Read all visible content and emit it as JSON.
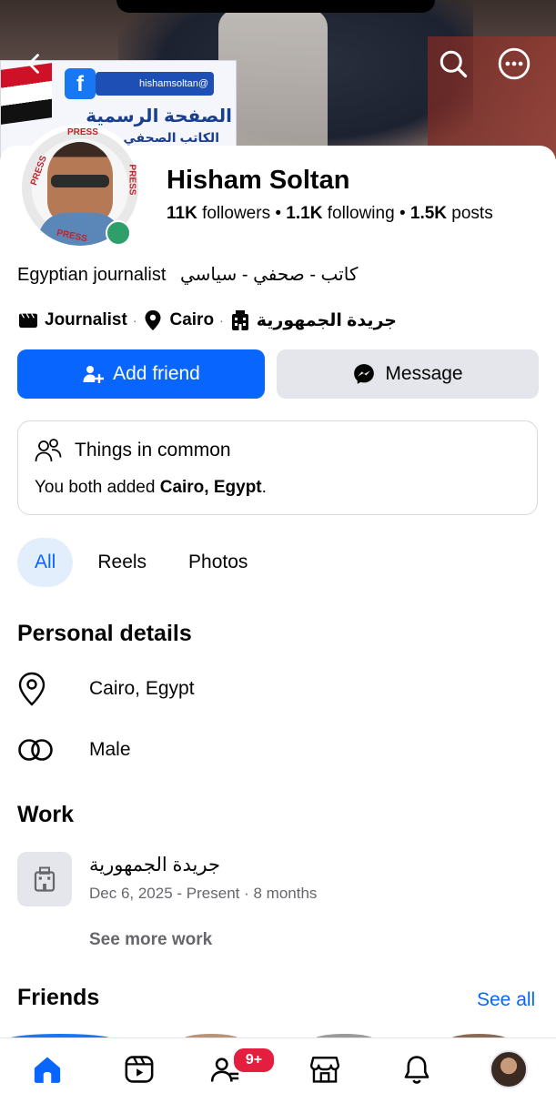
{
  "cover": {
    "poster_handle": "hishamsoltan@",
    "poster_line1": "الصفحة الرسمية",
    "poster_line2": "الكاتب الصحفي"
  },
  "profile": {
    "name": "Hisham Soltan",
    "followers_count": "11K",
    "followers_label": "followers",
    "following_count": "1.1K",
    "following_label": "following",
    "posts_count": "1.5K",
    "posts_label": "posts",
    "bio_en": "Egyptian journalist",
    "bio_ar": "كاتب - صحفي  - سياسي",
    "fact_job": "Journalist",
    "fact_city": "Cairo",
    "fact_employer": "جريدة الجمهورية",
    "avatar_press_top": "PRESS",
    "avatar_press_left": "PRESS",
    "avatar_press_right": "PRESS",
    "avatar_press_bottom": "PRESS"
  },
  "actions": {
    "add_friend": "Add friend",
    "message": "Message"
  },
  "common": {
    "title": "Things in common",
    "desc_prefix": "You both added ",
    "desc_place": "Cairo, Egypt",
    "desc_suffix": "."
  },
  "tabs": [
    "All",
    "Reels",
    "Photos"
  ],
  "personal": {
    "heading": "Personal details",
    "location": "Cairo, Egypt",
    "gender": "Male"
  },
  "work": {
    "heading": "Work",
    "employer": "جريدة الجمهورية",
    "dates": "Dec 6, 2025 - Present · 8 months",
    "see_more": "See more work"
  },
  "friends": {
    "heading": "Friends",
    "see_all": "See all"
  },
  "nav": {
    "badge": "9+",
    "accent": "#0866ff"
  }
}
